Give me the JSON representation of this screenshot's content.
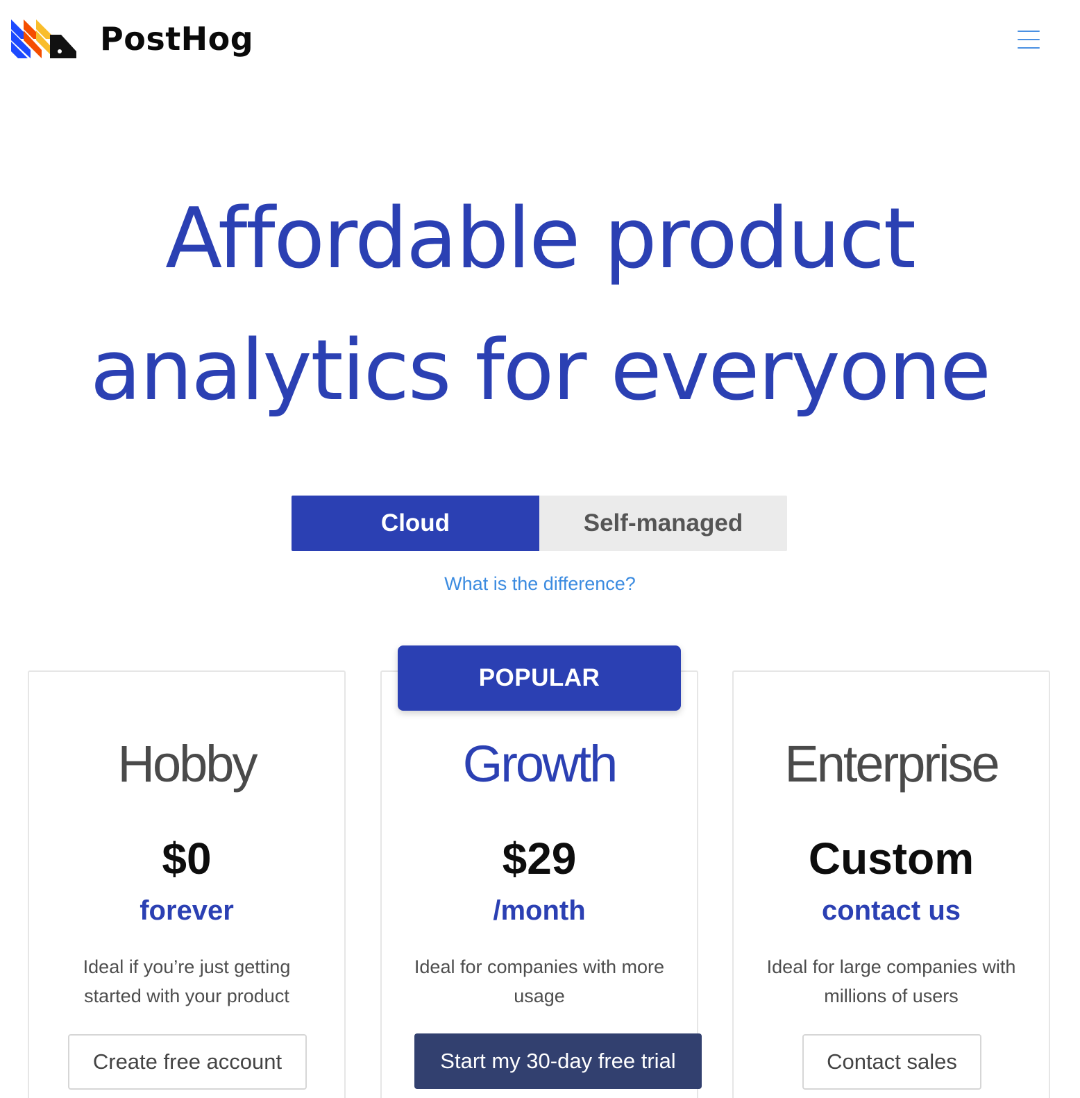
{
  "header": {
    "brand": "PostHog",
    "logo_icon": "posthog-logo-icon",
    "menu_icon": "hamburger-menu-icon"
  },
  "hero": {
    "title_line1": "Affordable product",
    "title_line2": "analytics for everyone"
  },
  "deployment_toggle": {
    "options": [
      {
        "label": "Cloud",
        "selected": true
      },
      {
        "label": "Self-managed",
        "selected": false
      }
    ],
    "difference_link": "What is the difference?"
  },
  "plans": [
    {
      "name": "Hobby",
      "price": "$0",
      "period": "forever",
      "description": "Ideal if you’re just getting started with your product",
      "cta": "Create free account"
    },
    {
      "badge": "POPULAR",
      "name": "Growth",
      "price": "$29",
      "period": "/month",
      "description": "Ideal for companies with more usage",
      "cta": "Start my 30-day free trial"
    },
    {
      "name": "Enterprise",
      "price": "Custom",
      "period": "contact us",
      "description": "Ideal for large companies with millions of users",
      "cta": "Contact sales"
    }
  ],
  "colors": {
    "brand_blue": "#2b40b3",
    "link_blue": "#3b8be0",
    "dark_button": "#32406f",
    "toggle_inactive": "#ebebeb"
  }
}
